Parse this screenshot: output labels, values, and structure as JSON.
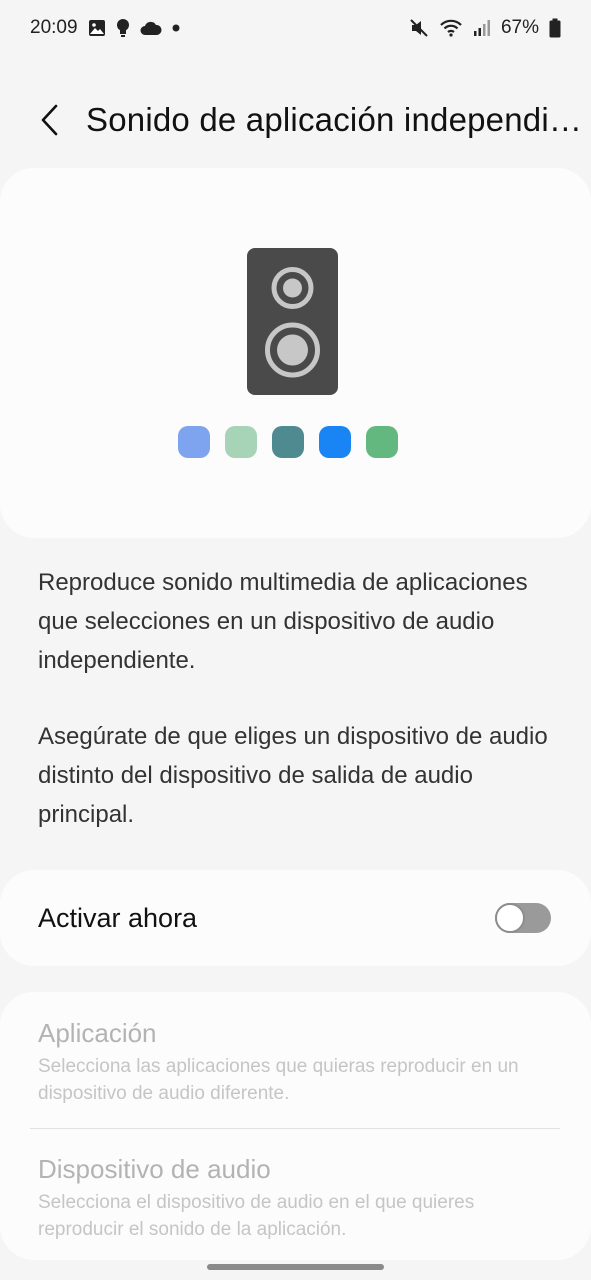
{
  "status_bar": {
    "time": "20:09",
    "battery": "67%",
    "icons": [
      "image-icon",
      "lightbulb-icon",
      "cloud-icon",
      "dot-icon",
      "mute-icon",
      "wifi-icon",
      "signal-icon",
      "battery-icon"
    ]
  },
  "header": {
    "title": "Sonido de aplicación independiente"
  },
  "illustration": {
    "speaker_color": "#4a4a4a",
    "dot_colors": [
      "#7ea3ef",
      "#a7d3b7",
      "#4e8a8f",
      "#1985f5",
      "#63b880"
    ]
  },
  "description": {
    "paragraph1": "Reproduce sonido multimedia de aplicaciones que selecciones en un dispositivo de audio independiente.",
    "paragraph2": "Asegúrate de que eliges un dispositivo de audio distinto del dispositivo de salida de audio principal."
  },
  "toggle": {
    "label": "Activar ahora",
    "state": "off"
  },
  "settings": {
    "items": [
      {
        "title": "Aplicación",
        "subtitle": "Selecciona las aplicaciones que quieras reproducir en un dispositivo de audio diferente."
      },
      {
        "title": "Dispositivo de audio",
        "subtitle": "Selecciona el dispositivo de audio en el que quieres reproducir el sonido de la aplicación."
      }
    ]
  }
}
